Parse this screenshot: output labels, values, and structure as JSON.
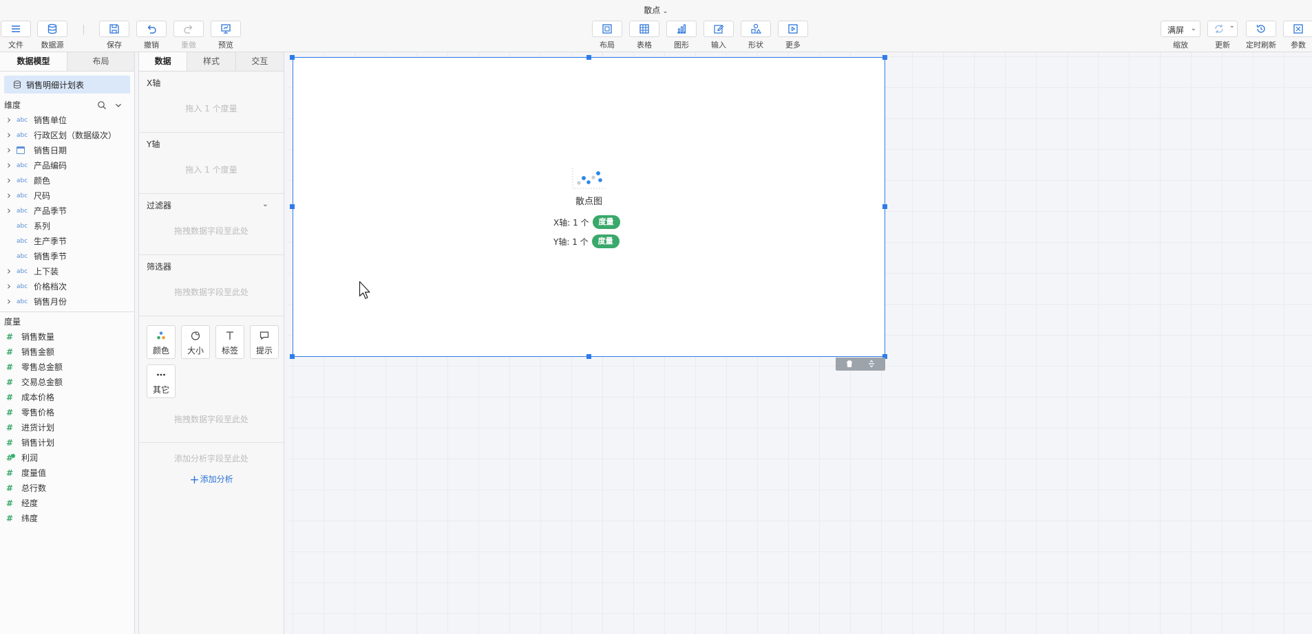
{
  "title": "散点",
  "toolbar": {
    "file": "文件",
    "datasource": "数据源",
    "save": "保存",
    "undo": "撤销",
    "redo": "重做",
    "preview": "预览",
    "layout": "布局",
    "table": "表格",
    "chart": "图形",
    "input": "输入",
    "shape": "形状",
    "more": "更多",
    "zoom_value": "满屏",
    "zoom": "缩放",
    "refresh": "更新",
    "timed_refresh": "定时刷新",
    "params": "参数"
  },
  "left_panel": {
    "tabs": [
      "数据模型",
      "布局"
    ],
    "dataset": "销售明细计划表",
    "dimensions_label": "维度",
    "dimensions": [
      {
        "name": "销售单位",
        "expandable": true,
        "type": "abc"
      },
      {
        "name": "行政区划（数据级次）",
        "expandable": true,
        "type": "abc"
      },
      {
        "name": "销售日期",
        "expandable": true,
        "type": "date"
      },
      {
        "name": "产品编码",
        "expandable": true,
        "type": "abc"
      },
      {
        "name": "颜色",
        "expandable": true,
        "type": "abc"
      },
      {
        "name": "尺码",
        "expandable": true,
        "type": "abc"
      },
      {
        "name": "产品季节",
        "expandable": true,
        "type": "abc"
      },
      {
        "name": "系列",
        "expandable": false,
        "type": "abc"
      },
      {
        "name": "生产季节",
        "expandable": false,
        "type": "abc"
      },
      {
        "name": "销售季节",
        "expandable": false,
        "type": "abc"
      },
      {
        "name": "上下装",
        "expandable": true,
        "type": "abc"
      },
      {
        "name": "价格档次",
        "expandable": true,
        "type": "abc"
      },
      {
        "name": "销售月份",
        "expandable": true,
        "type": "abc"
      }
    ],
    "measures_label": "度量",
    "measures": [
      {
        "name": "销售数量"
      },
      {
        "name": "销售金额"
      },
      {
        "name": "零售总金额"
      },
      {
        "name": "交易总金额"
      },
      {
        "name": "成本价格"
      },
      {
        "name": "零售价格"
      },
      {
        "name": "进货计划"
      },
      {
        "name": "销售计划"
      },
      {
        "name": "利润",
        "calculated": true
      },
      {
        "name": "度量值"
      },
      {
        "name": "总行数"
      },
      {
        "name": "经度"
      },
      {
        "name": "纬度"
      }
    ]
  },
  "mid_panel": {
    "tabs": [
      "数据",
      "样式",
      "交互"
    ],
    "x_axis": {
      "label": "X轴",
      "hint": "拖入 1 个度量"
    },
    "y_axis": {
      "label": "Y轴",
      "hint": "拖入 1 个度量"
    },
    "filter": {
      "label": "过滤器",
      "hint": "拖拽数据字段至此处"
    },
    "selector": {
      "label": "筛选器",
      "hint": "拖拽数据字段至此处"
    },
    "marks": {
      "color": "颜色",
      "size": "大小",
      "label": "标签",
      "tooltip": "提示",
      "other": "其它",
      "hint": "拖拽数据字段至此处"
    },
    "analysis": {
      "hint": "添加分析字段至此处",
      "add": "添加分析"
    }
  },
  "widget": {
    "chart_name": "散点图",
    "x_req": "X轴: 1 个",
    "y_req": "Y轴: 1 个",
    "pill": "度量"
  },
  "icon_names": {
    "delete": "trash-icon",
    "resize": "resize-icon"
  },
  "colors": {
    "accent": "#2f7bea",
    "measure_pill": "#3aa86b",
    "dataset_bg": "#dbe8fa"
  }
}
